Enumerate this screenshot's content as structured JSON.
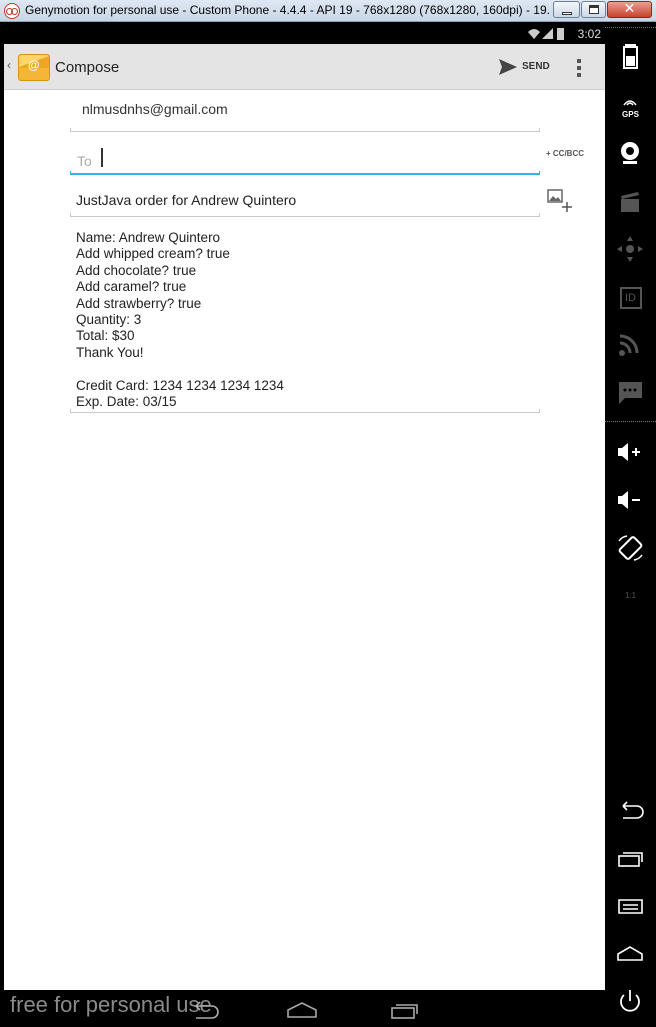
{
  "window": {
    "title": "Genymotion for personal use - Custom Phone - 4.4.4 - API 19 - 768x1280 (768x1280, 160dpi) - 19...",
    "close_glyph": "✕"
  },
  "status_bar": {
    "time": "3:02",
    "icons": [
      "wifi-icon",
      "signal-icon",
      "battery-icon"
    ]
  },
  "action_bar": {
    "app_icon_glyph": "@",
    "title": "Compose",
    "send_label": "SEND"
  },
  "compose": {
    "from": "nlmusdnhs@gmail.com",
    "to_placeholder": "To",
    "to_value": "",
    "cc_bcc_label": "+ CC/BCC",
    "subject": "JustJava order for Andrew Quintero",
    "body": "Name: Andrew Quintero\nAdd whipped cream? true\nAdd chocolate? true\nAdd caramel? true\nAdd strawberry? true\nQuantity: 3\nTotal: $30\nThank You!\n\nCredit Card: 1234 1234 1234 1234\nExp. Date: 03/15"
  },
  "sidebar": {
    "gps_label": "GPS",
    "id_label": "ID",
    "pixel_label": "1:1",
    "items": [
      "battery-icon",
      "gps-icon",
      "webcam-icon",
      "screencast-icon",
      "remote-control-icon",
      "device-id-icon",
      "rss-icon",
      "sms-icon",
      "volume-up-icon",
      "volume-down-icon",
      "rotate-icon",
      "pixel-perfect-icon",
      "back-icon",
      "recent-apps-icon",
      "menu-icon",
      "home-icon",
      "power-icon"
    ]
  },
  "navbar": {
    "watermark": "free for personal use"
  },
  "colors": {
    "accent": "#33b5e5",
    "actionbar": "#e4e4e4",
    "email_icon": "#f5b638"
  }
}
